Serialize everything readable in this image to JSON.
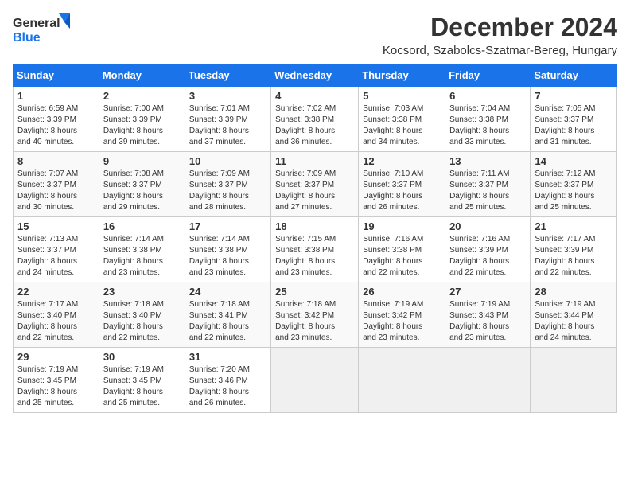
{
  "header": {
    "logo_line1": "General",
    "logo_line2": "Blue",
    "month": "December 2024",
    "location": "Kocsord, Szabolcs-Szatmar-Bereg, Hungary"
  },
  "weekdays": [
    "Sunday",
    "Monday",
    "Tuesday",
    "Wednesday",
    "Thursday",
    "Friday",
    "Saturday"
  ],
  "weeks": [
    [
      {
        "day": "1",
        "sunrise": "6:59 AM",
        "sunset": "3:39 PM",
        "daylight": "8 hours and 40 minutes."
      },
      {
        "day": "2",
        "sunrise": "7:00 AM",
        "sunset": "3:39 PM",
        "daylight": "8 hours and 39 minutes."
      },
      {
        "day": "3",
        "sunrise": "7:01 AM",
        "sunset": "3:39 PM",
        "daylight": "8 hours and 37 minutes."
      },
      {
        "day": "4",
        "sunrise": "7:02 AM",
        "sunset": "3:38 PM",
        "daylight": "8 hours and 36 minutes."
      },
      {
        "day": "5",
        "sunrise": "7:03 AM",
        "sunset": "3:38 PM",
        "daylight": "8 hours and 34 minutes."
      },
      {
        "day": "6",
        "sunrise": "7:04 AM",
        "sunset": "3:38 PM",
        "daylight": "8 hours and 33 minutes."
      },
      {
        "day": "7",
        "sunrise": "7:05 AM",
        "sunset": "3:37 PM",
        "daylight": "8 hours and 31 minutes."
      }
    ],
    [
      {
        "day": "8",
        "sunrise": "7:07 AM",
        "sunset": "3:37 PM",
        "daylight": "8 hours and 30 minutes."
      },
      {
        "day": "9",
        "sunrise": "7:08 AM",
        "sunset": "3:37 PM",
        "daylight": "8 hours and 29 minutes."
      },
      {
        "day": "10",
        "sunrise": "7:09 AM",
        "sunset": "3:37 PM",
        "daylight": "8 hours and 28 minutes."
      },
      {
        "day": "11",
        "sunrise": "7:09 AM",
        "sunset": "3:37 PM",
        "daylight": "8 hours and 27 minutes."
      },
      {
        "day": "12",
        "sunrise": "7:10 AM",
        "sunset": "3:37 PM",
        "daylight": "8 hours and 26 minutes."
      },
      {
        "day": "13",
        "sunrise": "7:11 AM",
        "sunset": "3:37 PM",
        "daylight": "8 hours and 25 minutes."
      },
      {
        "day": "14",
        "sunrise": "7:12 AM",
        "sunset": "3:37 PM",
        "daylight": "8 hours and 25 minutes."
      }
    ],
    [
      {
        "day": "15",
        "sunrise": "7:13 AM",
        "sunset": "3:37 PM",
        "daylight": "8 hours and 24 minutes."
      },
      {
        "day": "16",
        "sunrise": "7:14 AM",
        "sunset": "3:38 PM",
        "daylight": "8 hours and 23 minutes."
      },
      {
        "day": "17",
        "sunrise": "7:14 AM",
        "sunset": "3:38 PM",
        "daylight": "8 hours and 23 minutes."
      },
      {
        "day": "18",
        "sunrise": "7:15 AM",
        "sunset": "3:38 PM",
        "daylight": "8 hours and 23 minutes."
      },
      {
        "day": "19",
        "sunrise": "7:16 AM",
        "sunset": "3:38 PM",
        "daylight": "8 hours and 22 minutes."
      },
      {
        "day": "20",
        "sunrise": "7:16 AM",
        "sunset": "3:39 PM",
        "daylight": "8 hours and 22 minutes."
      },
      {
        "day": "21",
        "sunrise": "7:17 AM",
        "sunset": "3:39 PM",
        "daylight": "8 hours and 22 minutes."
      }
    ],
    [
      {
        "day": "22",
        "sunrise": "7:17 AM",
        "sunset": "3:40 PM",
        "daylight": "8 hours and 22 minutes."
      },
      {
        "day": "23",
        "sunrise": "7:18 AM",
        "sunset": "3:40 PM",
        "daylight": "8 hours and 22 minutes."
      },
      {
        "day": "24",
        "sunrise": "7:18 AM",
        "sunset": "3:41 PM",
        "daylight": "8 hours and 22 minutes."
      },
      {
        "day": "25",
        "sunrise": "7:18 AM",
        "sunset": "3:42 PM",
        "daylight": "8 hours and 23 minutes."
      },
      {
        "day": "26",
        "sunrise": "7:19 AM",
        "sunset": "3:42 PM",
        "daylight": "8 hours and 23 minutes."
      },
      {
        "day": "27",
        "sunrise": "7:19 AM",
        "sunset": "3:43 PM",
        "daylight": "8 hours and 23 minutes."
      },
      {
        "day": "28",
        "sunrise": "7:19 AM",
        "sunset": "3:44 PM",
        "daylight": "8 hours and 24 minutes."
      }
    ],
    [
      {
        "day": "29",
        "sunrise": "7:19 AM",
        "sunset": "3:45 PM",
        "daylight": "8 hours and 25 minutes."
      },
      {
        "day": "30",
        "sunrise": "7:19 AM",
        "sunset": "3:45 PM",
        "daylight": "8 hours and 25 minutes."
      },
      {
        "day": "31",
        "sunrise": "7:20 AM",
        "sunset": "3:46 PM",
        "daylight": "8 hours and 26 minutes."
      },
      null,
      null,
      null,
      null
    ]
  ],
  "labels": {
    "sunrise": "Sunrise:",
    "sunset": "Sunset:",
    "daylight": "Daylight:"
  }
}
